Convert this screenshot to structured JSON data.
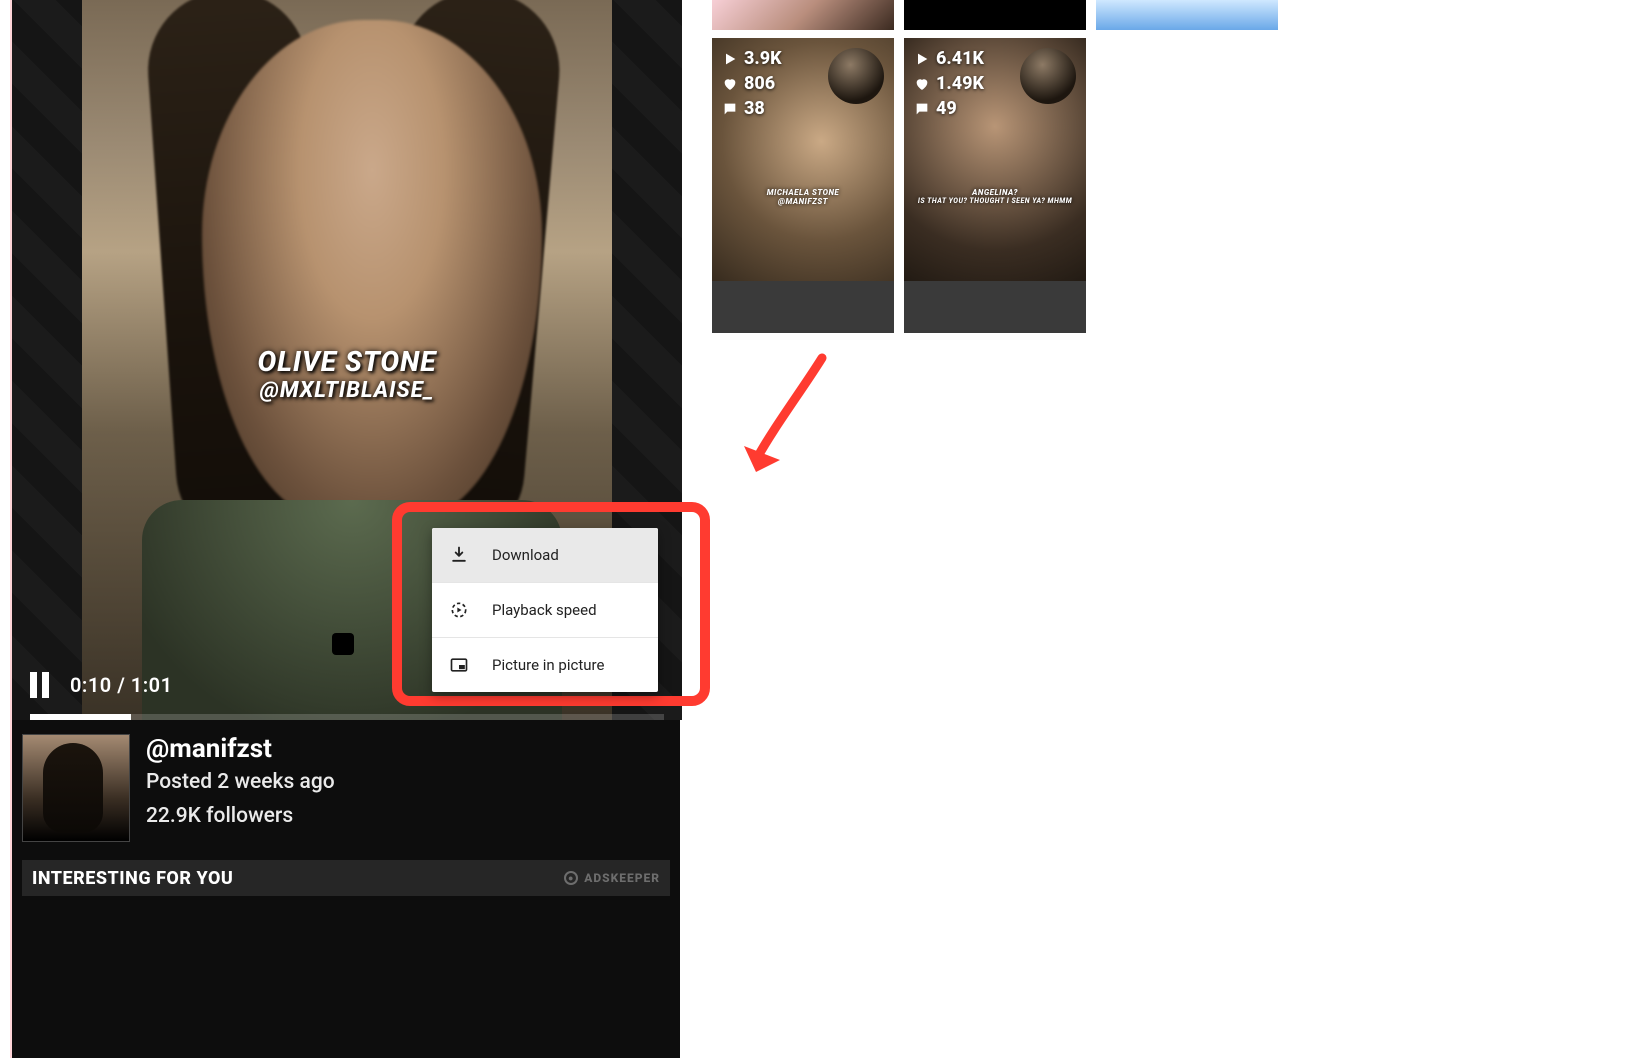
{
  "video": {
    "caption_line1": "OLIVE STONE",
    "caption_line2": "@MXLTIBLAISE_",
    "time_current": "0:10",
    "time_total": "1:01",
    "time_display": "0:10 / 1:01",
    "progress_percent": 16
  },
  "context_menu": {
    "items": [
      {
        "icon": "download",
        "label": "Download",
        "hover": true
      },
      {
        "icon": "playback-speed",
        "label": "Playback speed",
        "hover": false
      },
      {
        "icon": "pip",
        "label": "Picture in picture",
        "hover": false
      }
    ]
  },
  "author": {
    "handle": "@manifzst",
    "posted": "Posted 2 weeks ago",
    "followers": "22.9K followers"
  },
  "interesting": {
    "title": "INTERESTING FOR YOU",
    "sponsor": "ADSKEEPER"
  },
  "thumbs_top": [
    {
      "style": "pink"
    },
    {
      "style": "black"
    },
    {
      "style": "blue"
    }
  ],
  "thumbs_main": [
    {
      "views": "3.9K",
      "likes": "806",
      "comments": "38",
      "caption_line1": "MICHAELA STONE",
      "caption_line2": "@MANIFZST"
    },
    {
      "views": "6.41K",
      "likes": "1.49K",
      "comments": "49",
      "caption_line1": "ANGELINA?",
      "caption_line2": "IS THAT YOU? THOUGHT I SEEN YA? MHMM"
    }
  ],
  "colors": {
    "annotation_red": "#ff3b30"
  }
}
